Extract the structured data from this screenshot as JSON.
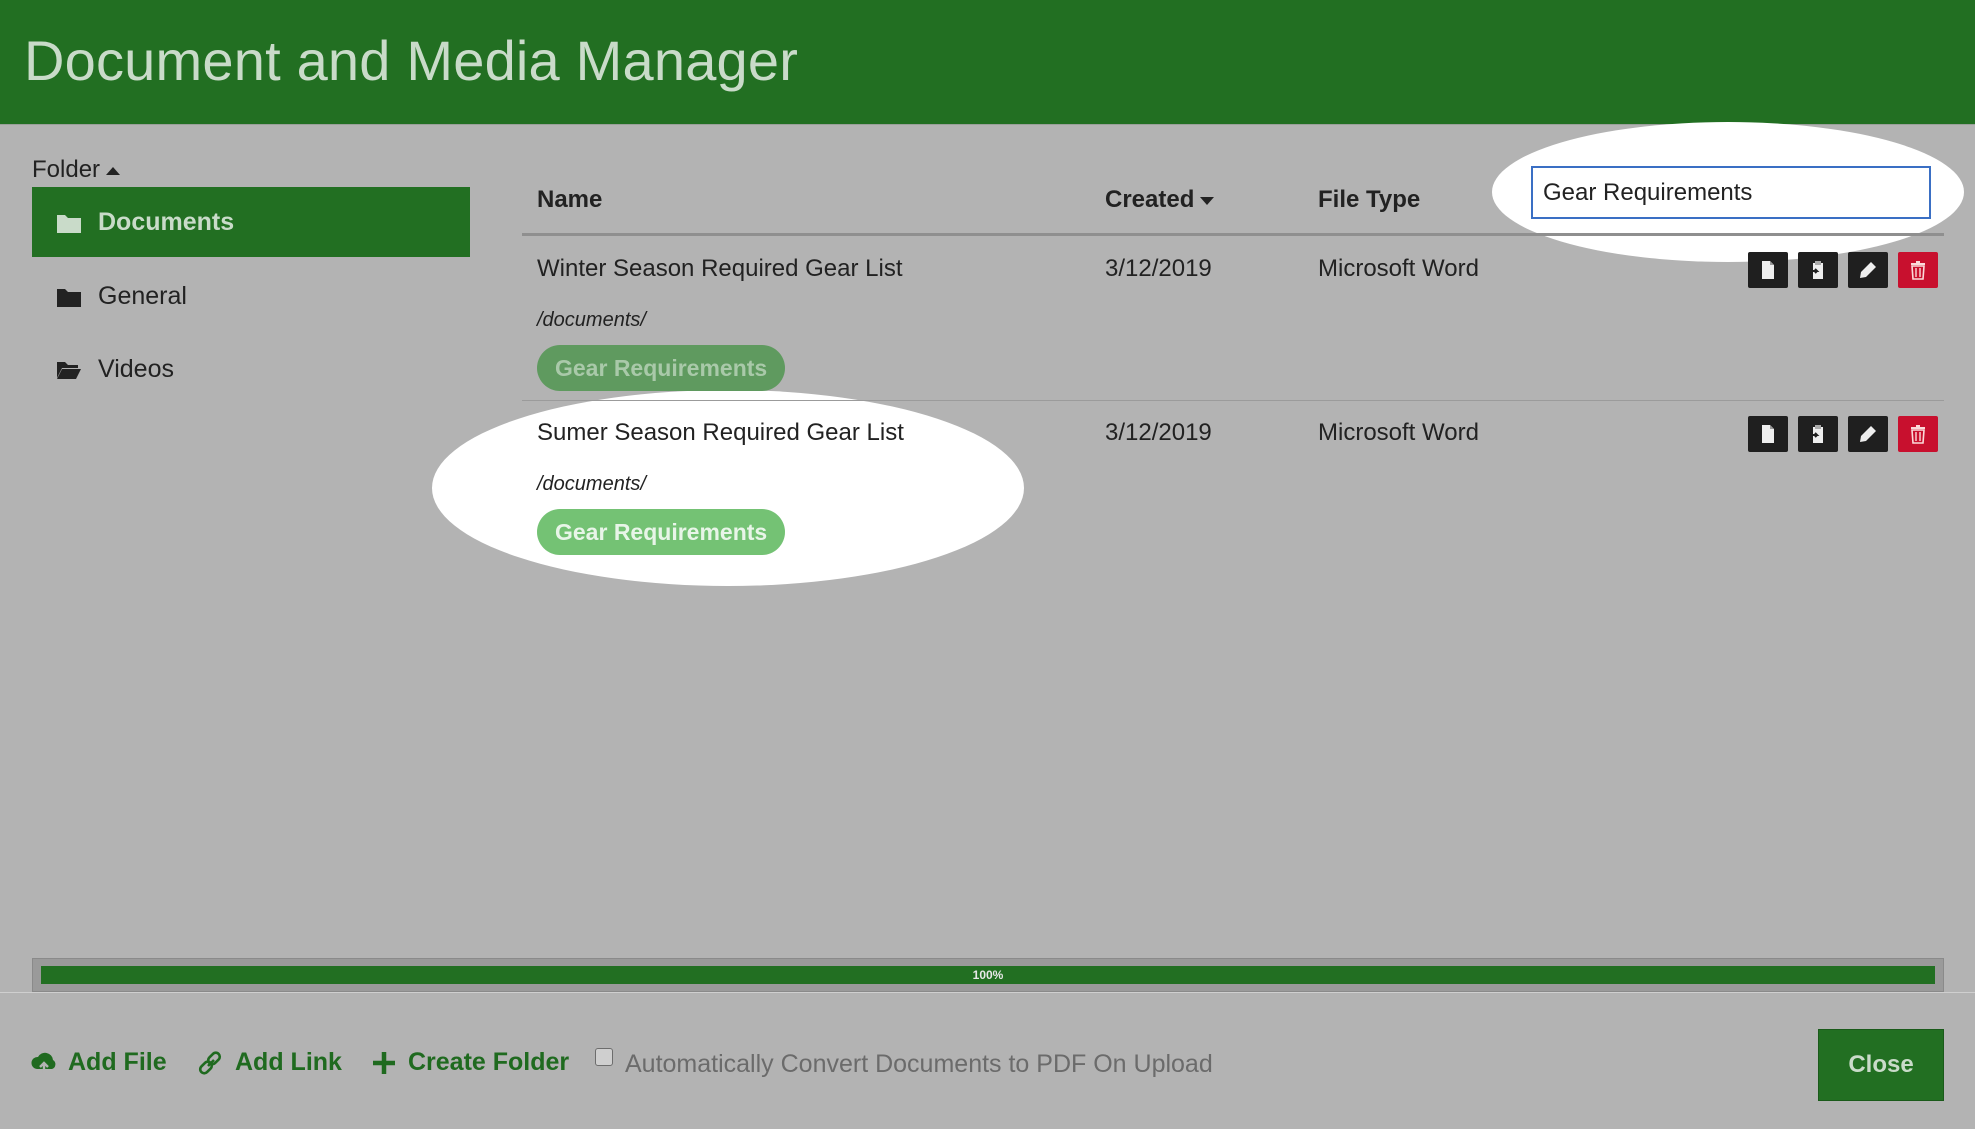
{
  "header": {
    "title": "Document and Media Manager"
  },
  "colors": {
    "brand": "#226f22",
    "danger": "#c8102e",
    "tag_dim": "#5f9a5f",
    "tag_bright": "#74c274"
  },
  "sidebar": {
    "heading": "Folder",
    "items": [
      {
        "label": "Documents",
        "icon": "folder-icon",
        "active": true
      },
      {
        "label": "General",
        "icon": "folder-icon",
        "active": false
      },
      {
        "label": "Videos",
        "icon": "folder-open-icon",
        "active": false
      }
    ]
  },
  "table": {
    "columns": {
      "name": "Name",
      "created": "Created",
      "file_type": "File Type"
    },
    "rows": [
      {
        "name": "Winter Season Required Gear List",
        "created": "3/12/2019",
        "file_type": "Microsoft Word",
        "path": "/documents/",
        "tag": "Gear Requirements"
      },
      {
        "name": "Sumer Season Required Gear List",
        "created": "3/12/2019",
        "file_type": "Microsoft Word",
        "path": "/documents/",
        "tag": "Gear Requirements"
      }
    ]
  },
  "search": {
    "value": "Gear Requirements"
  },
  "progress": {
    "label": "100%",
    "percent": 100
  },
  "footer": {
    "add_file": "Add File",
    "add_link": "Add Link",
    "create_folder": "Create Folder",
    "convert_label": "Automatically Convert Documents to PDF On Upload",
    "close": "Close"
  }
}
